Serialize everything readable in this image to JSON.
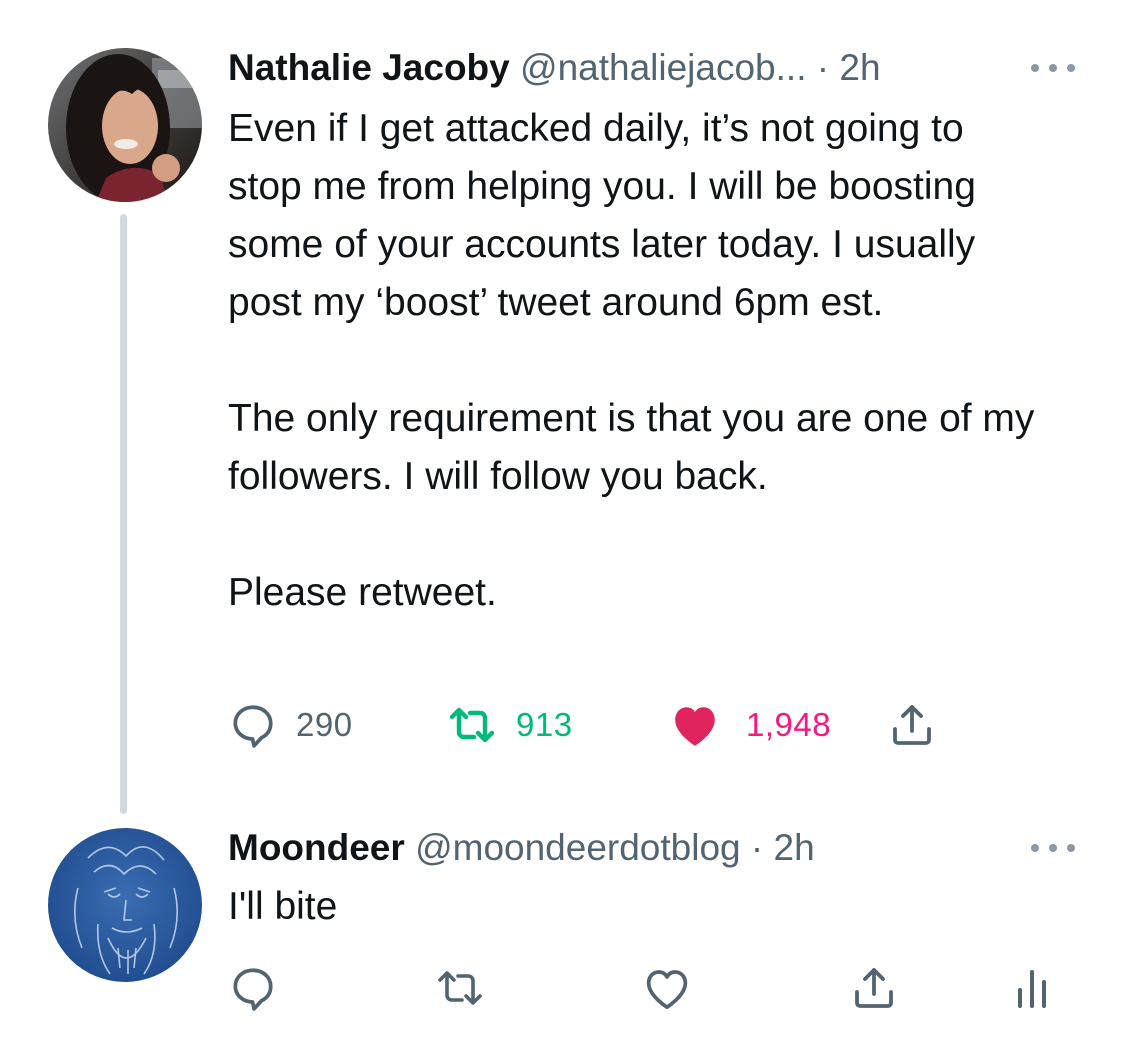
{
  "tweets": [
    {
      "author": {
        "name": "Nathalie Jacoby",
        "handle": "@nathaliejacob...",
        "separator": "·",
        "time": "2h"
      },
      "text": [
        "Even if I get attacked daily, it’s not going to stop me from helping you. I will be boosting some of your accounts later today. I usually post my ‘boost’ tweet around 6pm est.",
        "The only requirement is that you are one of my followers. I will follow you back.",
        "Please retweet."
      ],
      "actions": {
        "replies": "290",
        "retweets": "913",
        "likes": "1,948"
      },
      "icons": {
        "reply": "reply-icon",
        "retweet": "retweet-icon",
        "like": "heart-filled-icon",
        "share": "share-icon",
        "more": "more-icon"
      }
    },
    {
      "author": {
        "name": "Moondeer",
        "handle": "@moondeerdotblog",
        "separator": "·",
        "time": "2h"
      },
      "text": [
        "I'll bite"
      ],
      "icons": {
        "reply": "reply-icon",
        "retweet": "retweet-icon",
        "like": "heart-outline-icon",
        "share": "share-icon",
        "analytics": "analytics-icon",
        "more": "more-icon"
      }
    }
  ],
  "colors": {
    "text": "#0f1419",
    "secondary": "#536471",
    "retweet_active": "#00ba7c",
    "like_active": "#f91880",
    "heart": "#e0245e",
    "thread_line": "#cfd9de"
  }
}
